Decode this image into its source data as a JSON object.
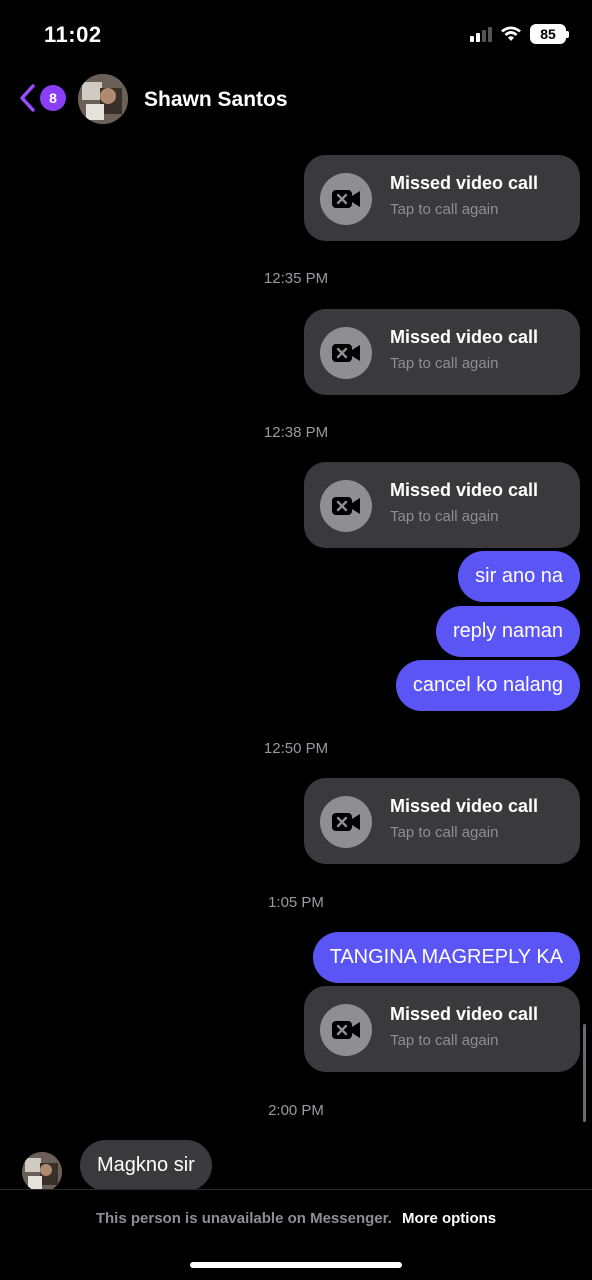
{
  "status_bar": {
    "time": "11:02",
    "battery": "85"
  },
  "header": {
    "unread_count": "8",
    "contact_name": "Shawn Santos"
  },
  "messages": {
    "call_title": "Missed video call",
    "call_subtitle": "Tap to call again",
    "timestamps": [
      "12:35 PM",
      "12:38 PM",
      "12:50 PM",
      "1:05 PM",
      "2:00 PM"
    ],
    "outgoing": [
      "sir ano na",
      "reply naman",
      "cancel ko nalang",
      "TANGINA MAGREPLY KA"
    ],
    "incoming": [
      "Magkno sir"
    ]
  },
  "footer": {
    "unavailable_text": "This person is unavailable on Messenger.",
    "more_options": "More options"
  },
  "colors": {
    "outgoing_bubble": "#5b55f5",
    "call_bubble": "#3a3a3c",
    "badge": "#8a3ff7",
    "accent": "#8a3ff7"
  },
  "icons": [
    "wifi-icon",
    "signal-icon",
    "battery-icon",
    "back-chevron-icon",
    "video-call-missed-icon"
  ]
}
